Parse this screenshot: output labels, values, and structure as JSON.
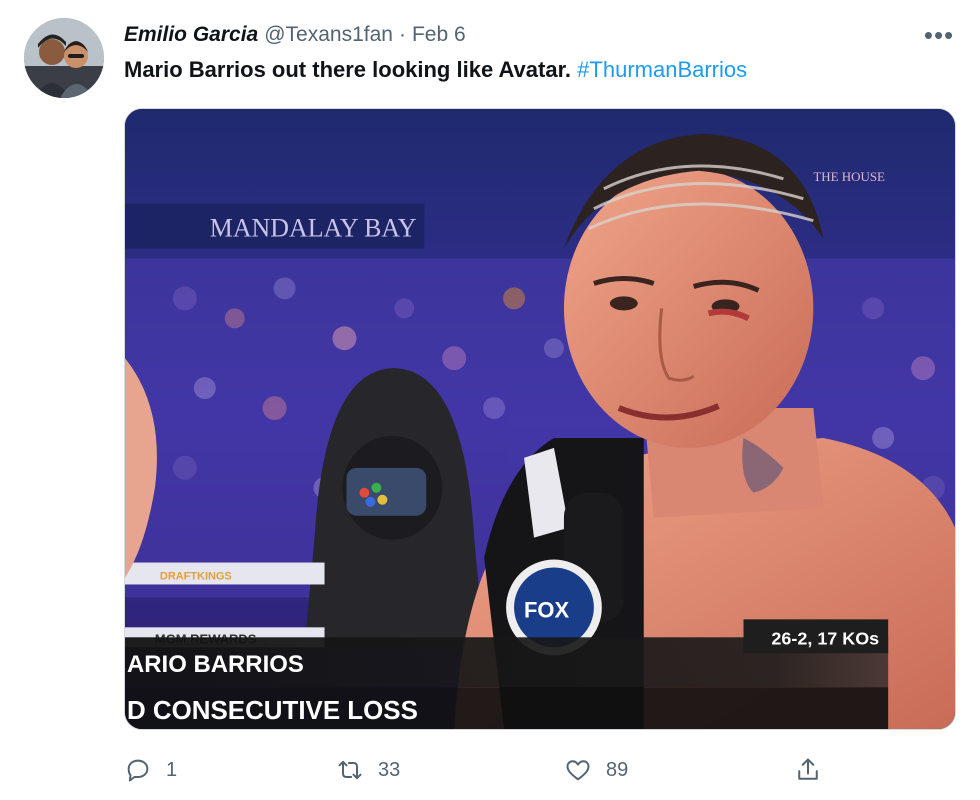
{
  "tweet": {
    "display_name": "Emilio Garcia",
    "handle": "@Texans1fan",
    "separator": "·",
    "date": "Feb 6",
    "more_label": "•••",
    "text": "Mario Barrios out there looking like Avatar.",
    "hashtag": "#ThurmanBarrios"
  },
  "media": {
    "arena_sign": "MANDALAY BAY",
    "house_sign": "THE HOUSE",
    "ring_sponsor_1": "DRAFTKINGS",
    "ring_sponsor_2": "MGM REWARDS",
    "mic_logo": "FOX",
    "record": "26-2, 17 KOs",
    "fighter_name": "ARIO BARRIOS",
    "subtitle": "D CONSECUTIVE LOSS"
  },
  "actions": {
    "reply_count": "1",
    "retweet_count": "33",
    "like_count": "89"
  },
  "colors": {
    "link": "#1d9bf0",
    "muted": "#536471",
    "text": "#0f1419"
  },
  "icons": [
    "reply-icon",
    "retweet-icon",
    "like-icon",
    "share-icon",
    "more-icon"
  ]
}
